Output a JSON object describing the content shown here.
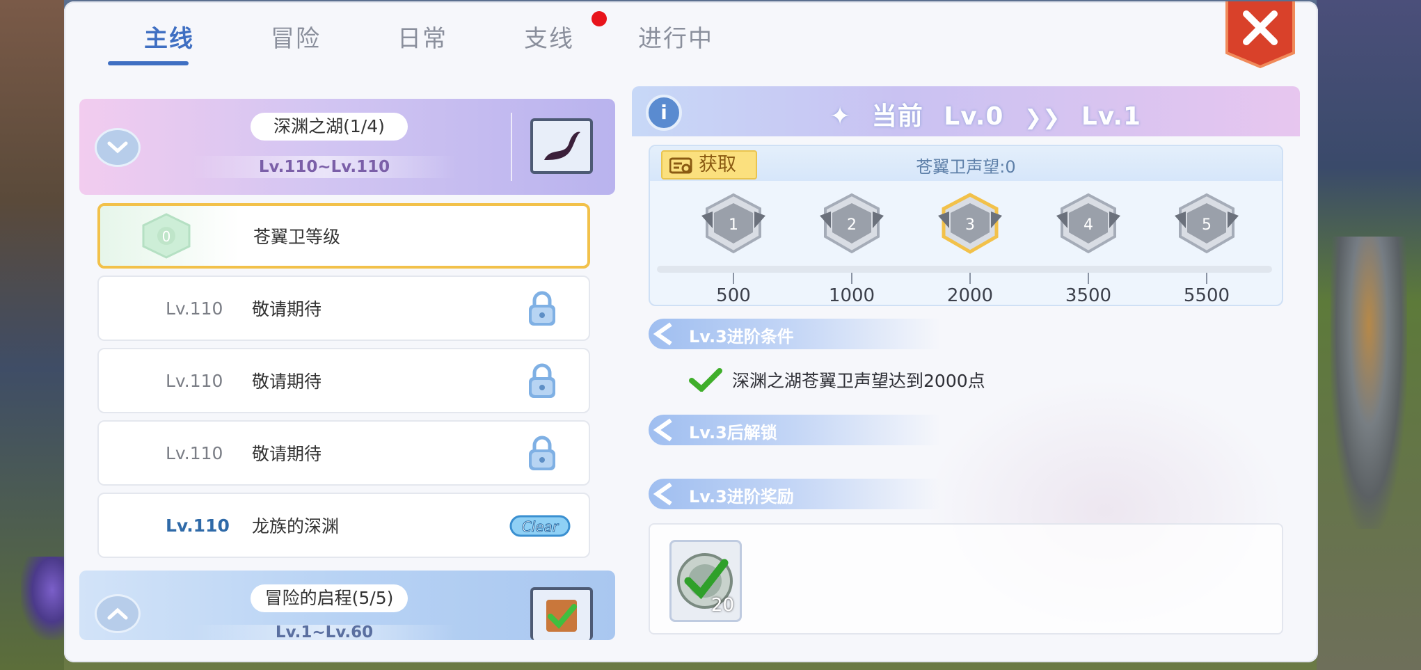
{
  "tabs": [
    {
      "label": "主线",
      "active": true
    },
    {
      "label": "冒险",
      "active": false
    },
    {
      "label": "日常",
      "active": false
    },
    {
      "label": "支线",
      "active": false,
      "notification": true
    },
    {
      "label": "进行中",
      "active": false
    }
  ],
  "chapters": [
    {
      "name": "深渊之湖(1/4)",
      "level_range": "Lv.110~Lv.110",
      "expanded": true
    },
    {
      "name": "冒险的启程(5/5)",
      "level_range": "Lv.1~Lv.60",
      "expanded": false
    }
  ],
  "quests": [
    {
      "name": "苍翼卫等级",
      "selected": true,
      "badge_level": "0"
    },
    {
      "lv": "Lv.110",
      "name": "敬请期待",
      "locked": true
    },
    {
      "lv": "Lv.110",
      "name": "敬请期待",
      "locked": true
    },
    {
      "lv": "Lv.110",
      "name": "敬请期待",
      "locked": true
    },
    {
      "lv": "Lv.110",
      "name": "龙族的深渊",
      "cleared": true,
      "clear_label": "Clear"
    }
  ],
  "detail": {
    "current_label": "当前",
    "from_level": "Lv.0",
    "to_level": "Lv.1",
    "get_button": "获取",
    "reputation_label": "苍翼卫声望:0",
    "tiers": [
      {
        "num": "1",
        "points": "500"
      },
      {
        "num": "2",
        "points": "1000"
      },
      {
        "num": "3",
        "points": "2000",
        "highlighted": true
      },
      {
        "num": "4",
        "points": "3500"
      },
      {
        "num": "5",
        "points": "5500"
      }
    ],
    "sections": {
      "conditions": "Lv.3进阶条件",
      "unlocks": "Lv.3后解锁",
      "rewards": "Lv.3进阶奖励"
    },
    "condition_text": "深渊之湖苍翼卫声望达到2000点",
    "reward_qty": "20"
  },
  "colors": {
    "accent": "#3f6fc2",
    "close": "#d9412a",
    "highlight": "#f2c14a"
  }
}
